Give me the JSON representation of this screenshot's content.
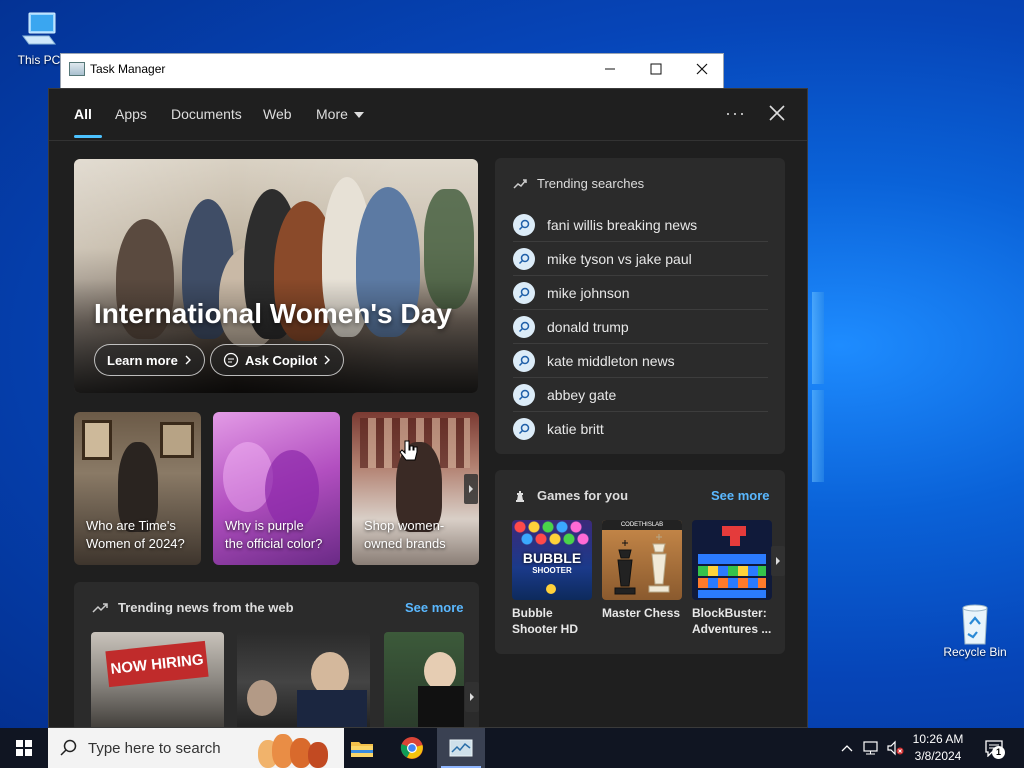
{
  "desktop": {
    "icons": [
      {
        "label": "This PC"
      },
      {
        "label": "Recycle Bin"
      }
    ]
  },
  "task_manager": {
    "title": "Task Manager",
    "minimize": "—",
    "maximize": "☐",
    "close": "✕"
  },
  "search_flyout": {
    "tabs": [
      {
        "label": "All"
      },
      {
        "label": "Apps"
      },
      {
        "label": "Documents"
      },
      {
        "label": "Web"
      },
      {
        "label": "More"
      }
    ],
    "hero": {
      "title": "International Women's Day",
      "learn_more": "Learn more",
      "ask_copilot": "Ask Copilot"
    },
    "cards": [
      {
        "caption_line1": "Who are Time's",
        "caption_line2": "Women of 2024?"
      },
      {
        "caption_line1": "Why is purple",
        "caption_line2": "the official color?"
      },
      {
        "caption_line1": "Shop women-",
        "caption_line2": "owned brands"
      }
    ],
    "trending_news": {
      "title": "Trending news from the web",
      "see_more": "See more",
      "thumb_text": "NOW HIRING"
    },
    "trending_searches": {
      "title": "Trending searches",
      "items": [
        "fani willis breaking news",
        "mike tyson vs jake paul",
        "mike johnson",
        "donald trump",
        "kate middleton news",
        "abbey gate",
        "katie britt"
      ]
    },
    "games": {
      "title": "Games for you",
      "see_more": "See more",
      "items": [
        {
          "name_line1": "Bubble",
          "name_line2": "Shooter HD",
          "art_text": "BUBBLE",
          "art_sub": "SHOOTER"
        },
        {
          "name_line1": "Master Chess",
          "name_line2": "",
          "art_text": "CODETHISLAB"
        },
        {
          "name_line1": "BlockBuster:",
          "name_line2": "Adventures ..."
        }
      ]
    }
  },
  "taskbar": {
    "search_placeholder": "Type here to search",
    "time": "10:26 AM",
    "date": "3/8/2024",
    "notification_count": "1"
  }
}
